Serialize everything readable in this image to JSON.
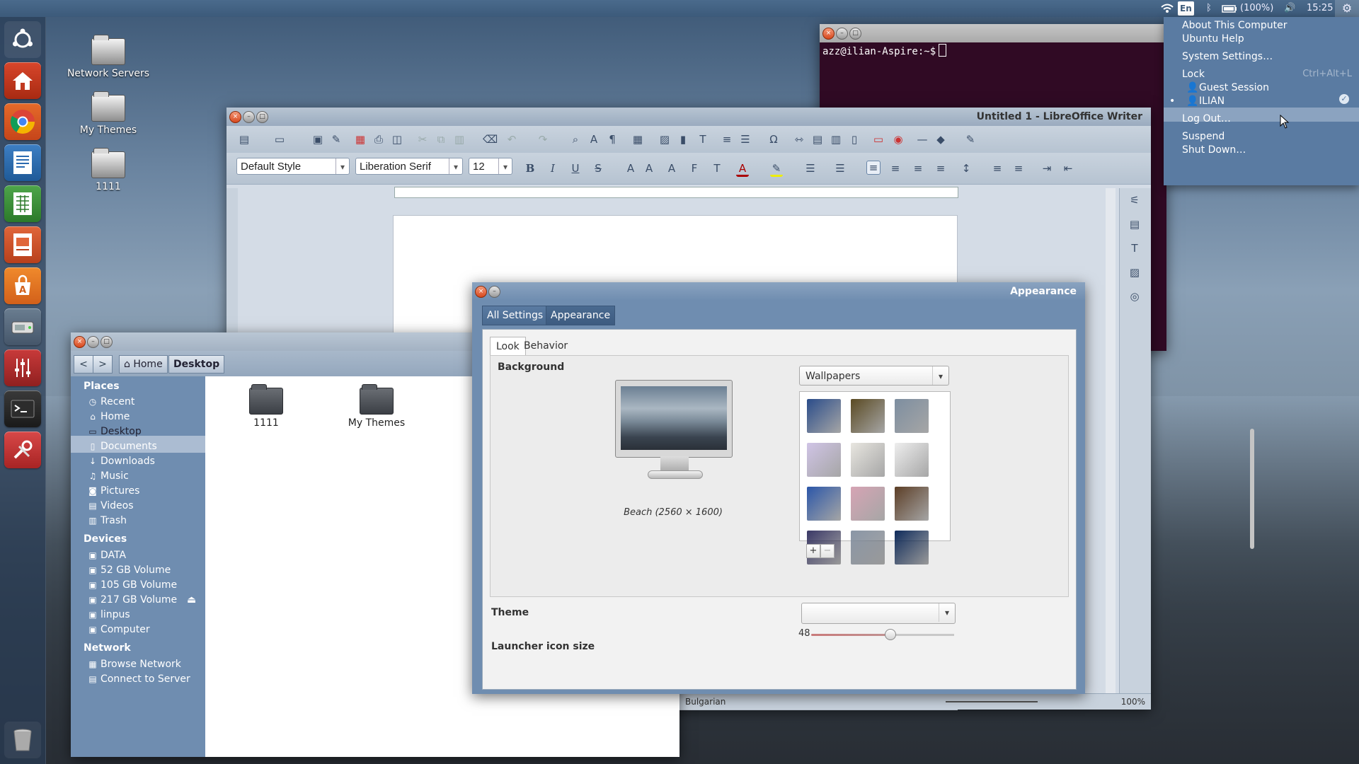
{
  "top_panel": {
    "keyboard_layout": "En",
    "battery": "(100%)",
    "clock": "15:25",
    "icons": [
      "wifi-icon",
      "bluetooth-icon",
      "battery-icon",
      "volume-icon",
      "gear-icon"
    ]
  },
  "launcher": {
    "items": [
      "ubuntu-dash-icon",
      "home-folder-icon",
      "chrome-icon",
      "writer-icon",
      "calc-icon",
      "impress-icon",
      "software-center-icon",
      "disk-icon",
      "mixer-icon",
      "terminal-icon",
      "settings-tool-icon",
      "trash-icon"
    ]
  },
  "desktop": {
    "icons": [
      "Network Servers",
      "My Themes",
      "1111"
    ]
  },
  "terminal": {
    "prompt": "azz@ilian-Aspire:~$"
  },
  "writer": {
    "title": "Untitled 1 - LibreOffice Writer",
    "paragraph_style": "Default Style",
    "font_name": "Liberation Serif",
    "font_size": "12",
    "language": "Bulgarian",
    "zoom": "100%"
  },
  "files": {
    "breadcrumb": [
      "Home",
      "Desktop"
    ],
    "places_header": "Places",
    "places": [
      {
        "label": "Recent",
        "icon": "clock-icon"
      },
      {
        "label": "Home",
        "icon": "home-icon"
      },
      {
        "label": "Desktop",
        "icon": "desktop-icon"
      },
      {
        "label": "Documents",
        "icon": "document-icon"
      },
      {
        "label": "Downloads",
        "icon": "download-icon"
      },
      {
        "label": "Music",
        "icon": "music-icon"
      },
      {
        "label": "Pictures",
        "icon": "camera-icon"
      },
      {
        "label": "Videos",
        "icon": "film-icon"
      },
      {
        "label": "Trash",
        "icon": "trash-icon"
      }
    ],
    "devices_header": "Devices",
    "devices": [
      "DATA",
      "52 GB Volume",
      "105 GB Volume",
      "217 GB Volume",
      "linpus",
      "Computer"
    ],
    "network_header": "Network",
    "network": [
      "Browse Network",
      "Connect to Server"
    ],
    "content": [
      "1111",
      "My Themes"
    ]
  },
  "appearance": {
    "title": "Appearance",
    "nav": [
      "All Settings",
      "Appearance"
    ],
    "tabs": [
      "Look",
      "Behavior"
    ],
    "background_label": "Background",
    "wallpaper_source": "Wallpapers",
    "caption": "Beach (2560 × 1600)",
    "theme_label": "Theme",
    "theme_value": "",
    "launcher_label": "Launcher icon size",
    "launcher_value": "48",
    "launcher_fraction": 0.55,
    "thumb_colors": [
      "#2a4c8a",
      "#5a4a22",
      "#7d8ea0",
      "#d0c4e6",
      "#e8e6e0",
      "#eeeeee",
      "#2b56a8",
      "#d6a4b4",
      "#5c3e26",
      "#3a3866",
      "#8a96a6",
      "#0e2a5a"
    ]
  },
  "session_menu": {
    "about": "About This Computer",
    "help": "Ubuntu Help",
    "settings": "System Settings…",
    "lock": "Lock",
    "lock_shortcut": "Ctrl+Alt+L",
    "guest": "Guest Session",
    "user": "ILIAN",
    "logout": "Log Out…",
    "suspend": "Suspend",
    "shutdown": "Shut Down…"
  }
}
